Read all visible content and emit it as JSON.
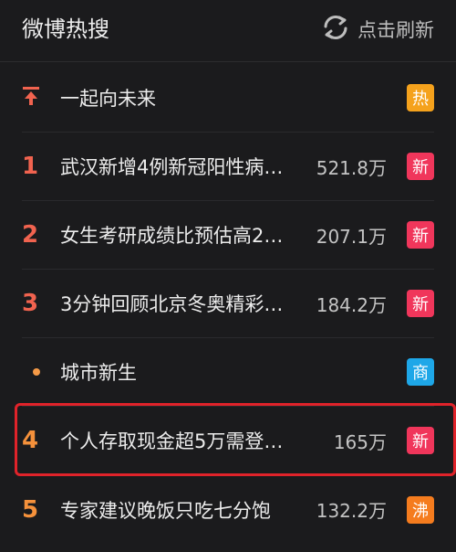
{
  "header": {
    "title": "微博热搜",
    "refresh_label": "点击刷新"
  },
  "colors": {
    "rank_red": "#f1634f",
    "rank_orange": "#f5913b",
    "badge_hot": "#f5a21c",
    "badge_new": "#f0365b",
    "badge_ad": "#1ea7e8",
    "badge_boil": "#f57c1e",
    "highlight": "#e0232a"
  },
  "items": [
    {
      "rank": "",
      "rank_icon": "pin-top-icon",
      "topic": "一起向未来",
      "count": "",
      "badge": "热",
      "badge_color": "#f5a21c"
    },
    {
      "rank": "1",
      "topic": "武汉新增4例新冠阳性病…",
      "count": "521.8万",
      "badge": "新",
      "badge_color": "#f0365b"
    },
    {
      "rank": "2",
      "topic": "女生考研成绩比预估高2…",
      "count": "207.1万",
      "badge": "新",
      "badge_color": "#f0365b"
    },
    {
      "rank": "3",
      "topic": "3分钟回顾北京冬奥精彩…",
      "count": "184.2万",
      "badge": "新",
      "badge_color": "#f0365b"
    },
    {
      "rank": "",
      "rank_icon": "dot-icon",
      "topic": "城市新生",
      "count": "",
      "badge": "商",
      "badge_color": "#1ea7e8"
    },
    {
      "rank": "4",
      "topic": "个人存取现金超5万需登…",
      "count": "165万",
      "badge": "新",
      "badge_color": "#f0365b"
    },
    {
      "rank": "5",
      "topic": "专家建议晚饭只吃七分饱",
      "count": "132.2万",
      "badge": "沸",
      "badge_color": "#f57c1e"
    }
  ]
}
